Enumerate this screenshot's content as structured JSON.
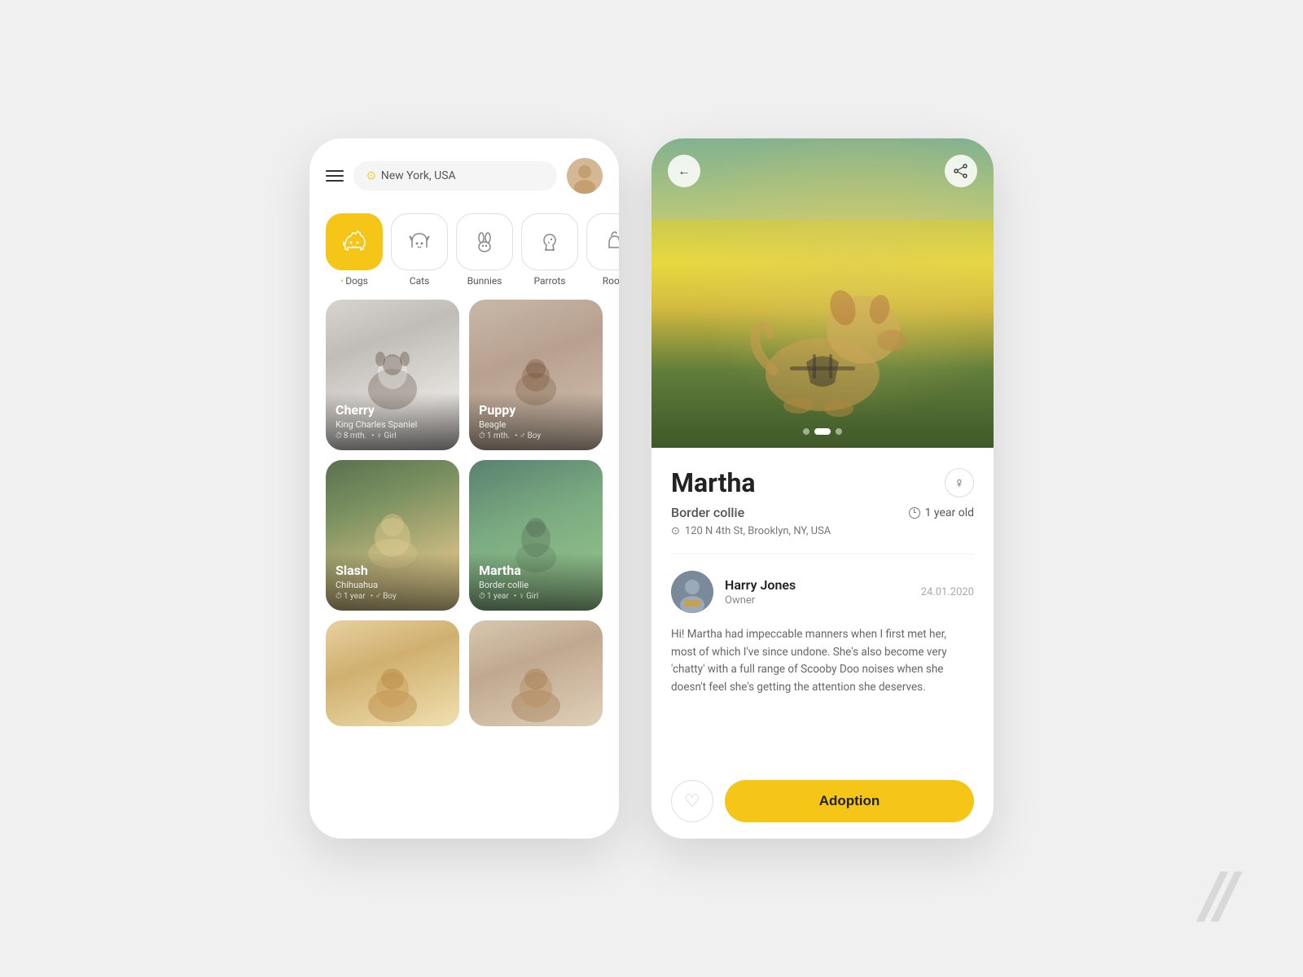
{
  "left_phone": {
    "location": "New York, USA",
    "categories": [
      {
        "id": "dogs",
        "label": "Dogs",
        "active": true
      },
      {
        "id": "cats",
        "label": "Cats",
        "active": false
      },
      {
        "id": "bunnies",
        "label": "Bunnies",
        "active": false
      },
      {
        "id": "parrots",
        "label": "Parrots",
        "active": false
      },
      {
        "id": "roosters",
        "label": "Roo...",
        "active": false
      }
    ],
    "pets": [
      {
        "name": "Cherry",
        "breed": "King Charles Spaniel",
        "age": "8 mth.",
        "gender": "Girl",
        "img_class": "pet-img-cherry",
        "card_size": "tall"
      },
      {
        "name": "Puppy",
        "breed": "Beagle",
        "age": "1 mth.",
        "gender": "Boy",
        "img_class": "pet-img-puppy",
        "card_size": "tall"
      },
      {
        "name": "Slash",
        "breed": "Chihuahua",
        "age": "1 year",
        "gender": "Boy",
        "img_class": "pet-img-slash",
        "card_size": "tall"
      },
      {
        "name": "Martha",
        "breed": "Border collie",
        "age": "1 year",
        "gender": "Girl",
        "img_class": "pet-img-martha",
        "card_size": "tall"
      }
    ]
  },
  "right_phone": {
    "pet": {
      "name": "Martha",
      "breed": "Border collie",
      "age": "1 year old",
      "gender_symbol": "♀",
      "location": "120 N 4th St, Brooklyn, NY, USA"
    },
    "owner": {
      "name": "Harry Jones",
      "role": "Owner",
      "date": "24.01.2020"
    },
    "description": "Hi! Martha had impeccable manners when I first met her, most of which I've since undone. She's also become very 'chatty' with a full range of Scooby Doo noises when she doesn't feel she's getting the attention she deserves.",
    "actions": {
      "adoption_label": "Adoption"
    }
  },
  "icons": {
    "back_arrow": "←",
    "share": "⤴",
    "location_pin": "⊙",
    "clock": "🕐",
    "heart": "♡",
    "female": "♀"
  }
}
